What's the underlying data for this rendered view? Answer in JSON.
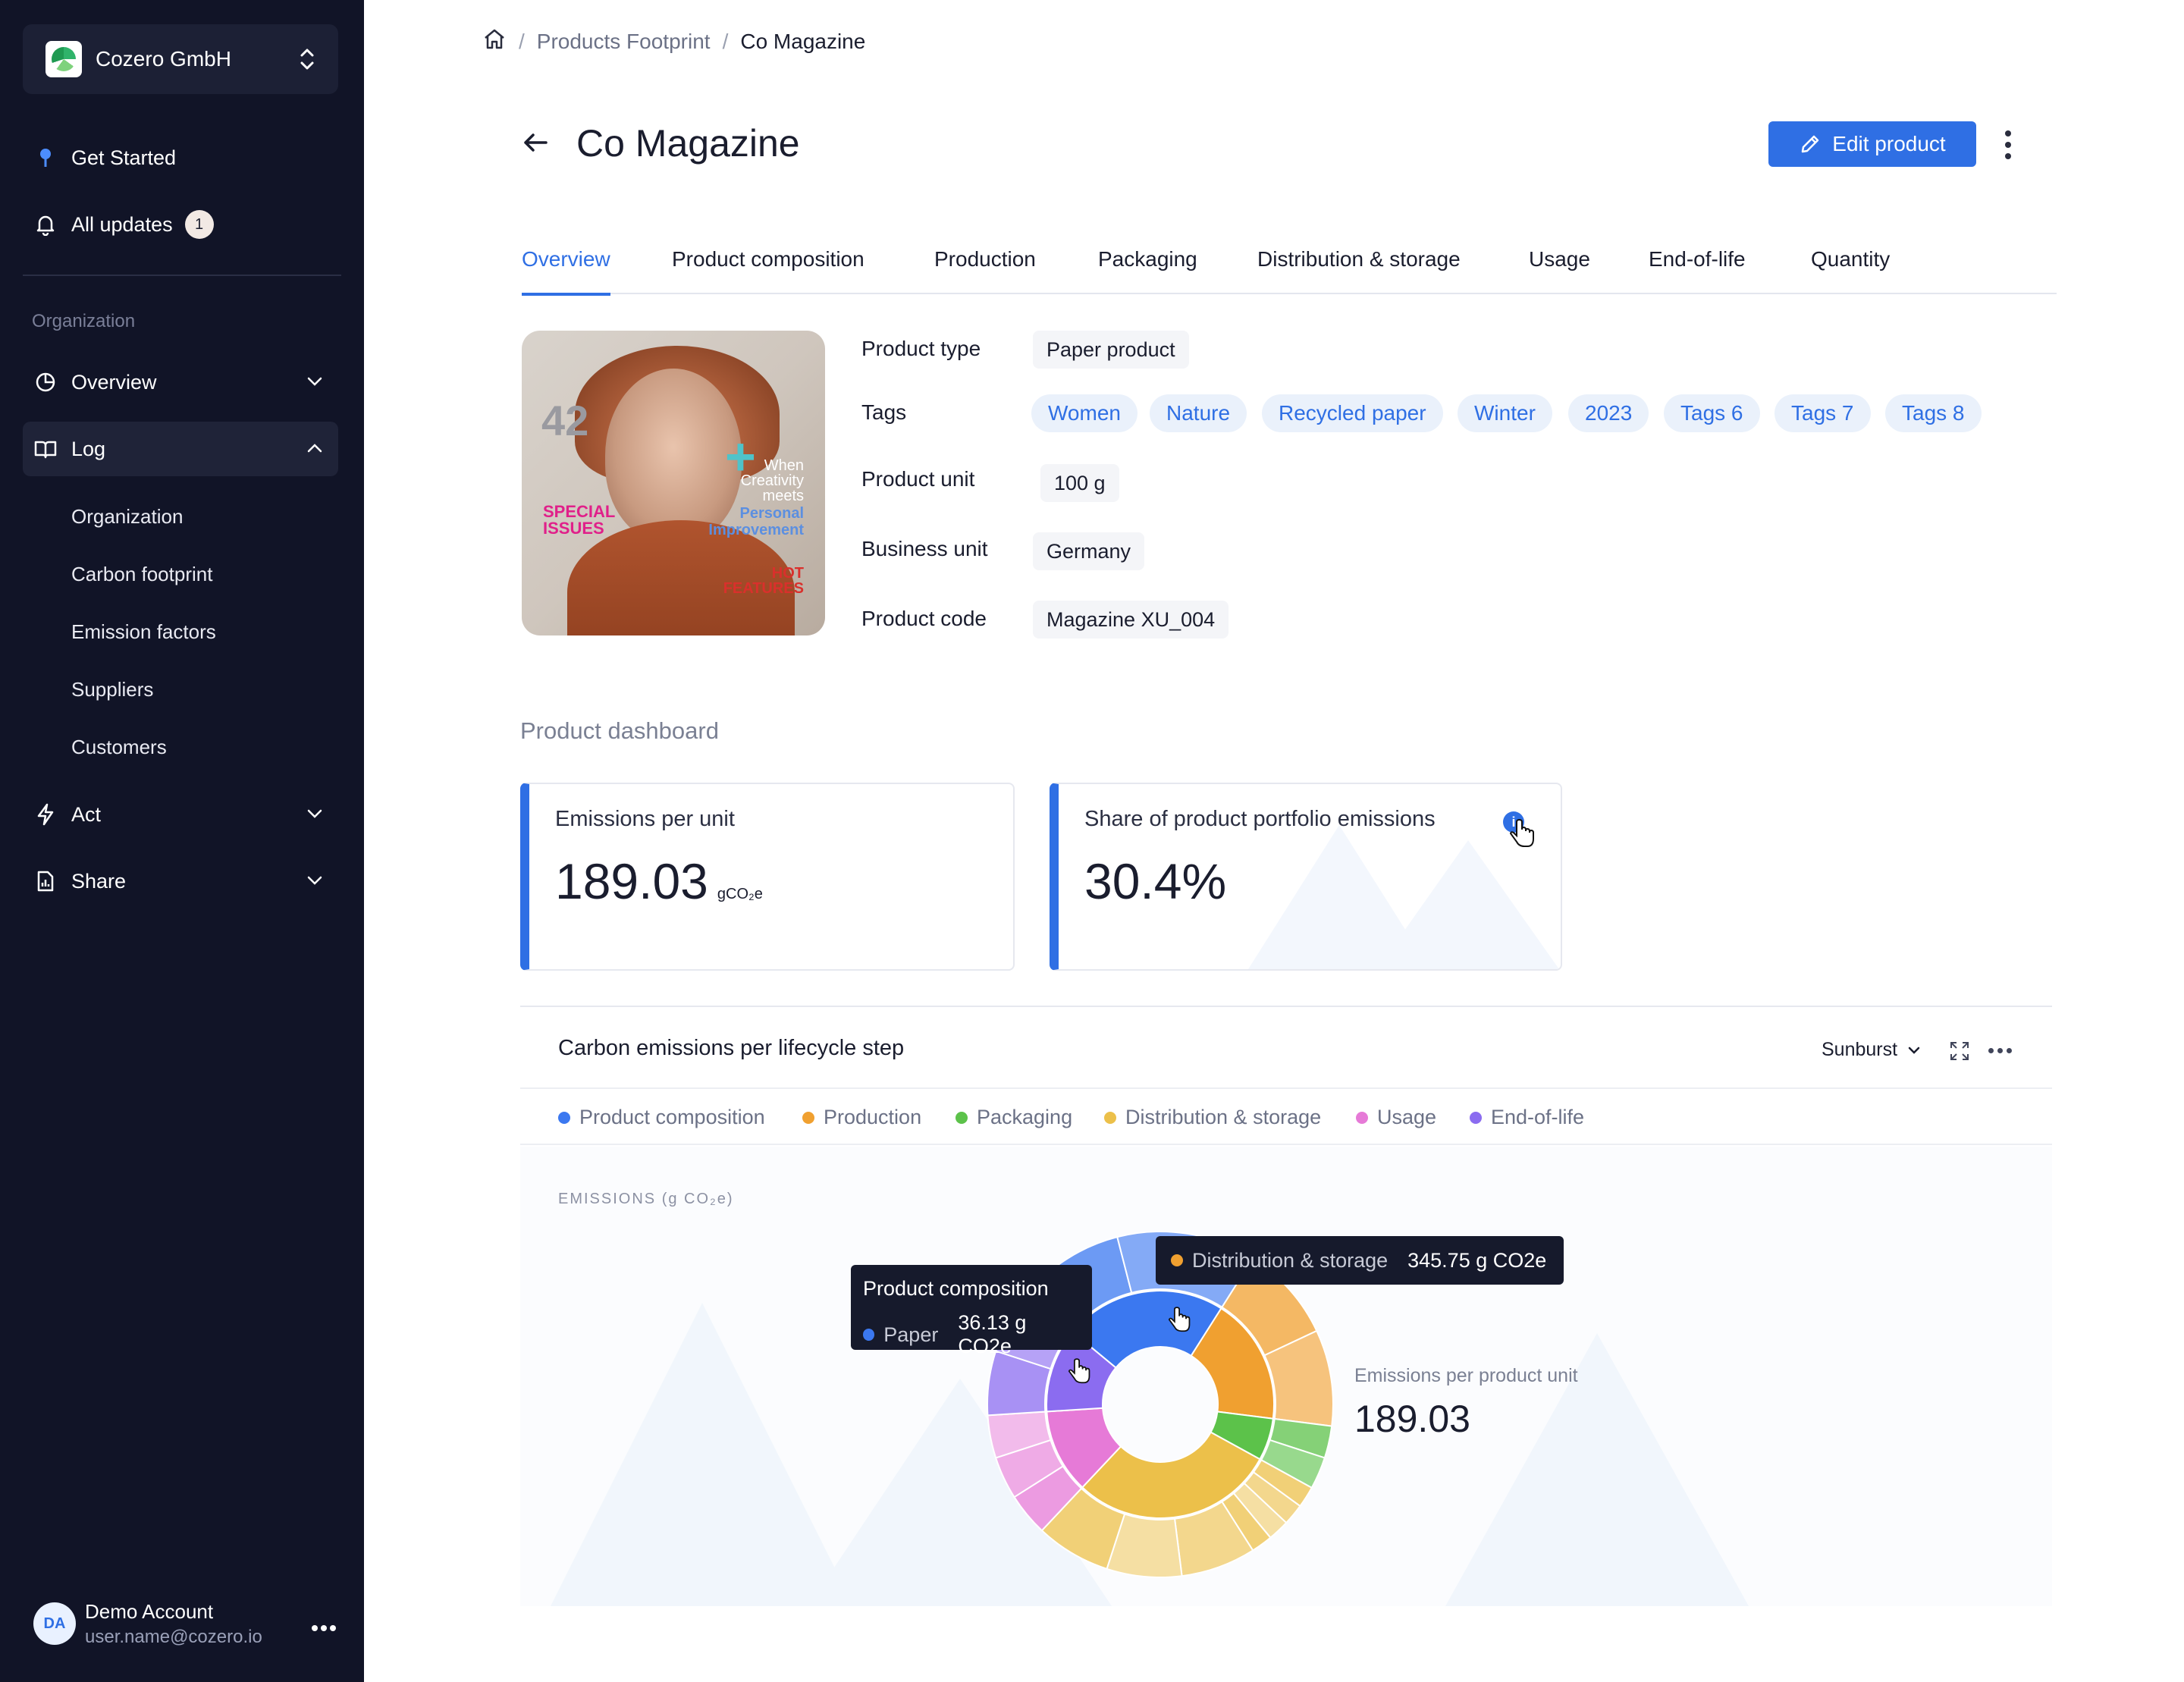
{
  "sidebar": {
    "org_name": "Cozero GmbH",
    "get_started": "Get Started",
    "all_updates": "All updates",
    "updates_count": "1",
    "section_label": "Organization",
    "overview": "Overview",
    "log": "Log",
    "log_items": [
      "Organization",
      "Carbon footprint",
      "Emission factors",
      "Suppliers",
      "Customers"
    ],
    "act": "Act",
    "share": "Share",
    "account": {
      "initials": "DA",
      "name": "Demo Account",
      "email": "user.name@cozero.io"
    }
  },
  "breadcrumb": {
    "section": "Products Footprint",
    "current": "Co Magazine"
  },
  "page": {
    "title": "Co Magazine",
    "edit_label": "Edit product"
  },
  "tabs": [
    "Overview",
    "Product composition",
    "Production",
    "Packaging",
    "Distribution & storage",
    "Usage",
    "End-of-life",
    "Quantity"
  ],
  "active_tab": "Overview",
  "product_image": {
    "number": "42",
    "special": "SPECIAL ISSUES",
    "when": "When Creativity meets",
    "personal": "Personal Improvement",
    "hot": "HOT FEATURES"
  },
  "properties": {
    "labels": {
      "type": "Product type",
      "tags": "Tags",
      "unit": "Product unit",
      "business": "Business unit",
      "code": "Product code"
    },
    "type": "Paper product",
    "tags": [
      "Women",
      "Nature",
      "Recycled paper",
      "Winter",
      "2023",
      "Tags 6",
      "Tags 7",
      "Tags 8"
    ],
    "unit": "100 g",
    "business_unit": "Germany",
    "code": "Magazine XU_004"
  },
  "dashboard": {
    "title": "Product dashboard",
    "emissions_per_unit": {
      "label": "Emissions per unit",
      "value": "189.03",
      "unit": "gCO₂e"
    },
    "portfolio_share": {
      "label": "Share of product portfolio emissions",
      "value": "30.4%"
    }
  },
  "chart_section": {
    "title": "Carbon emissions per lifecycle step",
    "chart_type": "Sunburst",
    "axis_caption": "EMISSIONS (g CO₂e)",
    "center_label": "Emissions per product unit",
    "center_value": "189.03",
    "tooltip_composition": {
      "title": "Product composition",
      "key": "Paper",
      "value": "36.13 g CO2e"
    },
    "tooltip_distribution": {
      "key": "Distribution & storage",
      "value": "345.75 g CO2e"
    }
  },
  "colors": {
    "accent": "#2f6fe4",
    "Product composition": "#3b78f0",
    "Production": "#f0a030",
    "Packaging": "#5cc24a",
    "Distribution & storage": "#ecc04a",
    "Usage": "#e67ad7",
    "End-of-life": "#8b6cf0"
  },
  "chart_data": {
    "type": "sunburst",
    "legend": [
      "Product composition",
      "Production",
      "Packaging",
      "Distribution & storage",
      "Usage",
      "End-of-life"
    ],
    "inner": [
      {
        "name": "Product composition",
        "value": 23
      },
      {
        "name": "Production",
        "value": 18
      },
      {
        "name": "Packaging",
        "value": 6
      },
      {
        "name": "Distribution & storage",
        "value": 29
      },
      {
        "name": "Usage",
        "value": 12
      },
      {
        "name": "End-of-life",
        "value": 12
      }
    ],
    "outer": [
      {
        "parent": "Product composition",
        "values": [
          10,
          13
        ]
      },
      {
        "parent": "Production",
        "values": [
          9,
          9
        ]
      },
      {
        "parent": "Packaging",
        "values": [
          3,
          3
        ]
      },
      {
        "parent": "Distribution & storage",
        "values": [
          2,
          2,
          2,
          2,
          7,
          7,
          7
        ]
      },
      {
        "parent": "Usage",
        "values": [
          4,
          4,
          4
        ]
      },
      {
        "parent": "End-of-life",
        "values": [
          6,
          6
        ]
      }
    ]
  }
}
